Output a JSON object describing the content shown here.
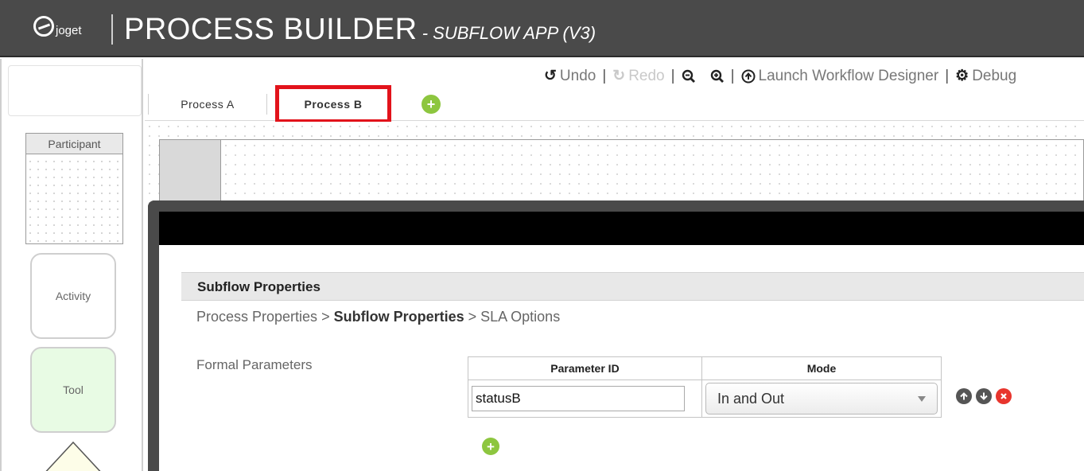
{
  "header": {
    "logo_text": "joget",
    "title": "PROCESS BUILDER",
    "subtitle": " - SUBFLOW APP (V3)"
  },
  "toolbar": {
    "undo": "Undo",
    "redo": "Redo",
    "launch": "Launch Workflow Designer",
    "debug": "Debug"
  },
  "tabs": {
    "items": [
      "Process A",
      "Process B"
    ],
    "selected": "Process B"
  },
  "palette": {
    "participant": "Participant",
    "activity": "Activity",
    "tool": "Tool"
  },
  "dialog": {
    "section_title": "Subflow Properties",
    "breadcrumb": {
      "step1": "Process Properties",
      "sep": " > ",
      "step2": "Subflow Properties",
      "step3": "SLA Options"
    },
    "formal_parameters_label": "Formal Parameters",
    "table": {
      "headers": [
        "Parameter ID",
        "Mode"
      ],
      "rows": [
        {
          "parameter_id": "statusB",
          "mode": "In and Out"
        }
      ]
    }
  },
  "colors": {
    "header_bg": "#4a4a4a",
    "highlight_red": "#e2131b",
    "add_green": "#8dc63f",
    "delete_red": "#e8352d",
    "tool_bg": "#e8fbe4"
  }
}
